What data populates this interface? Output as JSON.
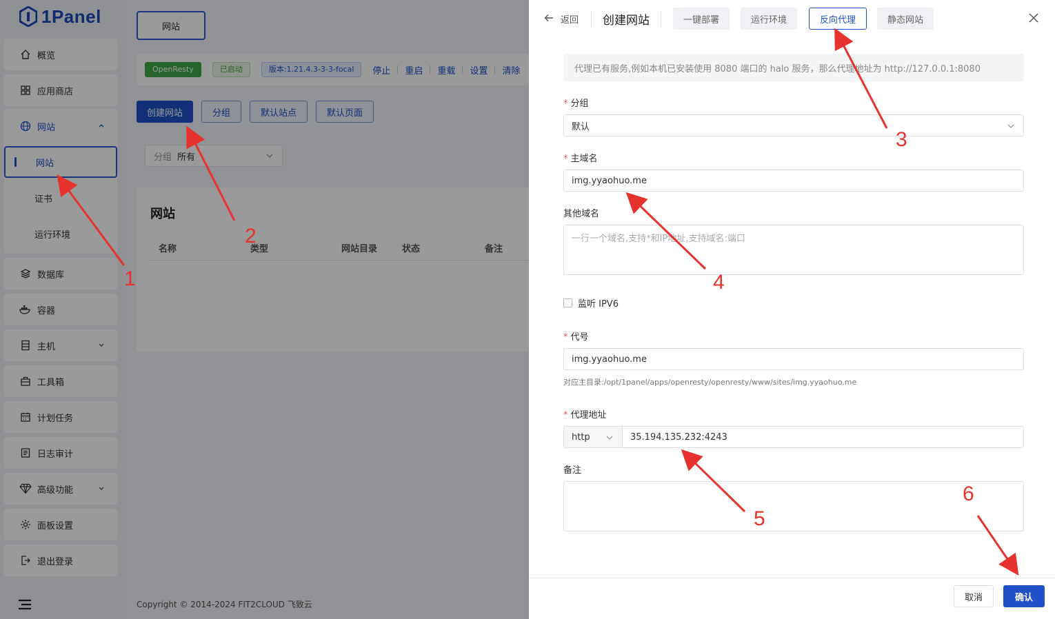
{
  "app": {
    "logo_text": "1Panel"
  },
  "sidebar": {
    "items": [
      {
        "label": "概览",
        "icon": "home-icon"
      },
      {
        "label": "应用商店",
        "icon": "grid-icon"
      },
      {
        "label": "网站",
        "icon": "globe-icon"
      },
      {
        "label": "数据库",
        "icon": "layers-icon"
      },
      {
        "label": "容器",
        "icon": "docker-icon"
      },
      {
        "label": "主机",
        "icon": "server-icon"
      },
      {
        "label": "工具箱",
        "icon": "toolbox-icon"
      },
      {
        "label": "计划任务",
        "icon": "calendar-icon"
      },
      {
        "label": "日志审计",
        "icon": "log-icon"
      },
      {
        "label": "高级功能",
        "icon": "diamond-icon"
      },
      {
        "label": "面板设置",
        "icon": "gear-icon"
      },
      {
        "label": "退出登录",
        "icon": "logout-icon"
      }
    ],
    "sub_items": [
      "网站",
      "证书",
      "运行环境"
    ]
  },
  "main": {
    "tab_label": "网站",
    "status": {
      "app_tag": "OpenResty",
      "state_tag": "已启动",
      "version_tag": "版本:1.21.4.3-3-3-focal",
      "ops": [
        "停止",
        "重启",
        "重载",
        "设置",
        "清除"
      ]
    },
    "buttons": [
      "创建网站",
      "分组",
      "默认站点",
      "默认页面"
    ],
    "filter": {
      "label": "分组",
      "value": "所有"
    },
    "panel_title": "网站",
    "columns": [
      "名称",
      "类型",
      "网站目录",
      "状态",
      "备注"
    ],
    "copyright": "Copyright © 2014-2024 FIT2CLOUD 飞致云"
  },
  "drawer": {
    "back_label": "返回",
    "title": "创建网站",
    "tabs": [
      "一键部署",
      "运行环境",
      "反向代理",
      "静态网站"
    ],
    "active_tab": "反向代理",
    "info_text": "代理已有服务,例如本机已安装使用 8080 端口的 halo 服务，那么代理地址为 http://127.0.0.1:8080",
    "group_label": "分组",
    "group_value": "默认",
    "primary_domain_label": "主域名",
    "primary_domain_value": "img.yyaohuo.me",
    "other_domains_label": "其他域名",
    "other_domains_placeholder": "一行一个域名,支持*和IP地址,支持域名:端口",
    "ipv6_label": "监听 IPV6",
    "alias_label": "代号",
    "alias_value": "img.yyaohuo.me",
    "alias_hint": "对应主目录:/opt/1panel/apps/openresty/openresty/www/sites/img.yyaohuo.me",
    "proxy_label": "代理地址",
    "proxy_protocol": "http",
    "proxy_address": "35.194.135.232:4243",
    "remark_label": "备注",
    "cancel_label": "取消",
    "confirm_label": "确认"
  },
  "annotations": [
    "1",
    "2",
    "3",
    "4",
    "5",
    "6"
  ],
  "colors": {
    "accent": "#1f50c8",
    "annotation": "#e8322e",
    "success": "#3fa84a"
  }
}
